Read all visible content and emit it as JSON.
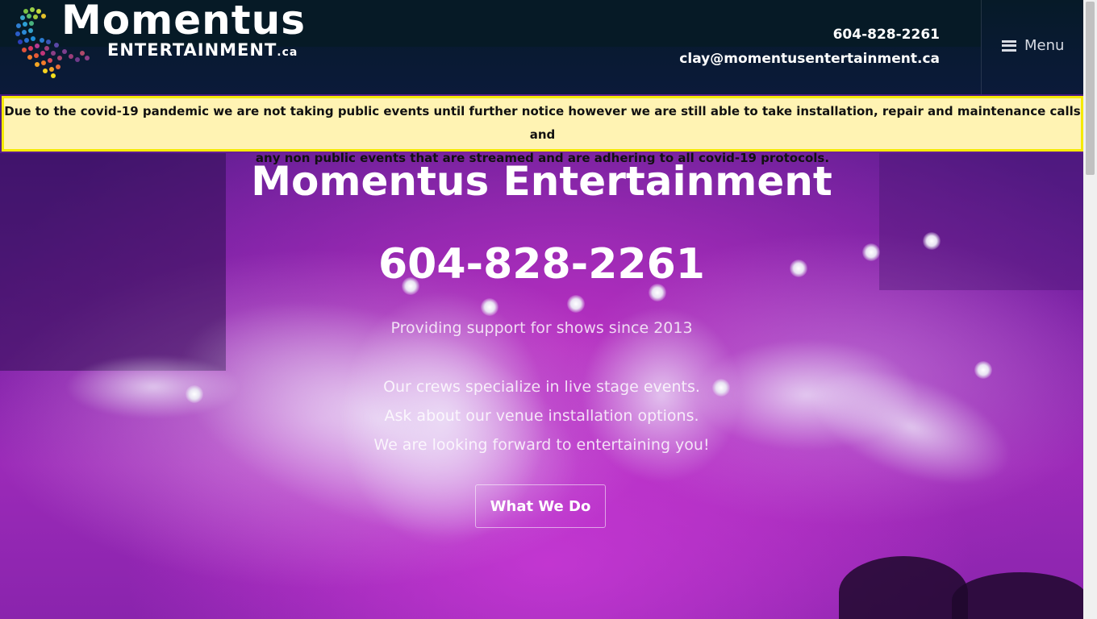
{
  "header": {
    "logo_main": "Momentus",
    "logo_sub": "ENTERTAINMENT",
    "logo_tld": ".ca",
    "phone": "604-828-2261",
    "email": "clay@momentusentertainment.ca",
    "menu_label": "Menu"
  },
  "notice": {
    "line1": "Due to the covid-19 pandemic we are not taking public events until further notice however we are still able to take installation, repair and maintenance calls and",
    "line2": "any non public events that are streamed and are adhering to all covid-19 protocols.",
    "background": "#fff3b3",
    "border_color": "#f5ea00"
  },
  "hero": {
    "title": "Momentus Entertainment",
    "phone": "604-828-2261",
    "subtitle": "Providing support for shows since 2013",
    "lines": [
      "Our crews specialize in live stage events.",
      "Ask about our venue installation options.",
      "We are looking forward to entertaining you!"
    ],
    "cta_label": "What We Do"
  },
  "icons": {
    "logo": "dotted-swirl-logo-icon",
    "menu": "hamburger-menu-icon"
  }
}
